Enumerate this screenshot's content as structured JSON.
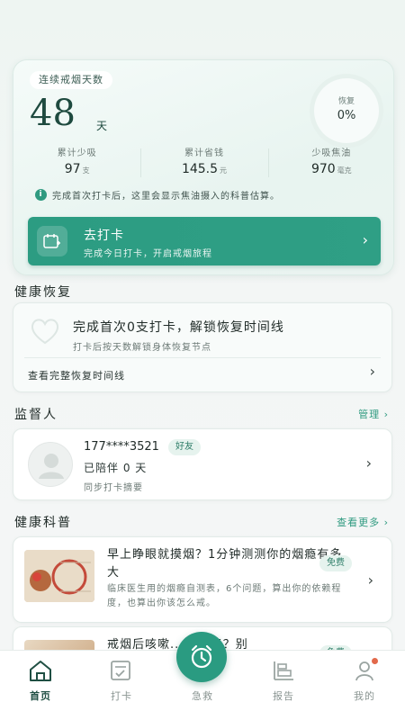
{
  "hero": {
    "label": "连续戒烟天数",
    "days": "48",
    "days_unit": "天",
    "recovery_label": "恢复",
    "recovery_value": "0%",
    "stats": [
      {
        "label": "累计少吸",
        "value": "97",
        "unit": "支"
      },
      {
        "label": "累计省钱",
        "value": "145.5",
        "unit": "元"
      },
      {
        "label": "少吸焦油",
        "value": "970",
        "unit": "毫克"
      }
    ],
    "note": "完成首次打卡后，这里会显示焦油摄入的科普估算。",
    "cta_title": "去打卡",
    "cta_sub": "完成今日打卡，开启戒烟旅程"
  },
  "recovery": {
    "section_title": "健康恢复",
    "title": "完成首次0支打卡，解锁恢复时间线",
    "sub": "打卡后按天数解锁身体恢复节点",
    "link": "查看完整恢复时间线"
  },
  "supervisor": {
    "section_title": "监督人",
    "manage": "管理 ›",
    "phone": "177****3521",
    "badge": "好友",
    "days": "已陪伴 0 天",
    "sub": "同步打卡摘要"
  },
  "science": {
    "section_title": "健康科普",
    "more": "查看更多 ›",
    "articles": [
      {
        "title": "早上睁眼就摸烟？1分钟测测你的烟瘾有多大",
        "sub": "临床医生用的烟瘾自测表，6个问题，算出你的依赖程度，也算出你该怎么戒。",
        "badge": "免费"
      },
      {
        "title": "戒烟后咳嗽......多了？别",
        "badge": "免费"
      }
    ]
  },
  "tabs": [
    {
      "label": "首页",
      "icon": "home-icon"
    },
    {
      "label": "打卡",
      "icon": "checkin-icon"
    },
    {
      "label": "急救",
      "icon": "alarm-clock-icon"
    },
    {
      "label": "报告",
      "icon": "report-icon"
    },
    {
      "label": "我的",
      "icon": "profile-icon"
    }
  ],
  "colors": {
    "accent": "#2c9c82",
    "dark": "#1e4a3f",
    "notification": "#e2694b"
  }
}
